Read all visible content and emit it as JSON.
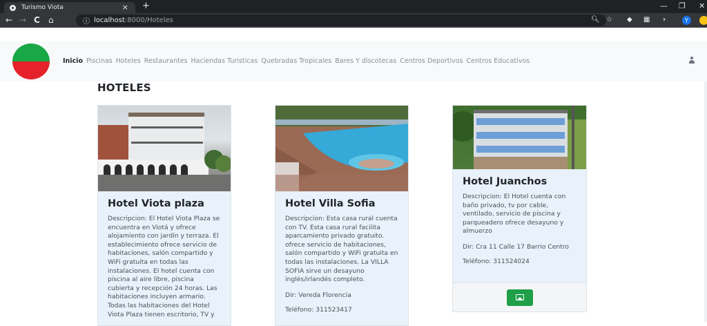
{
  "browser": {
    "tab_title": "Turismo Viota",
    "tab_close": "×",
    "new_tab": "+",
    "url_host": "localhost",
    "url_rest": ":8000/Hoteles",
    "profile_initial": "Y"
  },
  "nav": {
    "items": [
      "Inicio",
      "Piscinas",
      "Hoteles",
      "Restaurantes",
      "Haciendas Turisticas",
      "Quebradas Tropicales",
      "Bares Y discotecas",
      "Centros Deportivos",
      "Centros Educativos"
    ],
    "active_index": 0
  },
  "page": {
    "title": "HOTELES"
  },
  "hotels": [
    {
      "name": "Hotel Viota plaza",
      "description": "Descripcion: El Hotel Viota Plaza se encuentra en Viotá y ofrece alojamiento con jardín y terraza. El establecimiento ofrece servicio de habitaciones, salón compartido y WiFi gratuita en todas las instalaciones. El hotel cuenta con piscina al aire libre, piscina cubierta y recepción 24 horas. Las habitaciones incluyen armario. Todas las habitaciones del Hotel Viota Plaza tienen escritorio, TV y"
    },
    {
      "name": "Hotel Villa Sofia",
      "description": "Descripcion: Esta casa rural cuenta con TV. Esta casa rural facilita aparcamiento privado gratuito. ofrece servicio de habitaciones, salón compartido y WiFi gratuita en todas las instalaciones. La VILLA SOFIA sirve un desayuno inglés/irlandés completo.",
      "address": "Dir: Vereda Florencia",
      "phone": "Teléfono: 311523417"
    },
    {
      "name": "Hotel Juanchos",
      "description": "Descripcion: El Hotel cuenta con baño privado, tv por cable, ventilado, servicio de piscina y parqueadero ofrece desayuno y almuerzo",
      "address": "Dir: Cra 11 Calle 17 Barrio Centro",
      "phone": "Teléfono: 311524024"
    }
  ],
  "colors": {
    "flag_green": "#1aa745",
    "flag_red": "#e5222b",
    "button_green": "#1e9f48"
  }
}
